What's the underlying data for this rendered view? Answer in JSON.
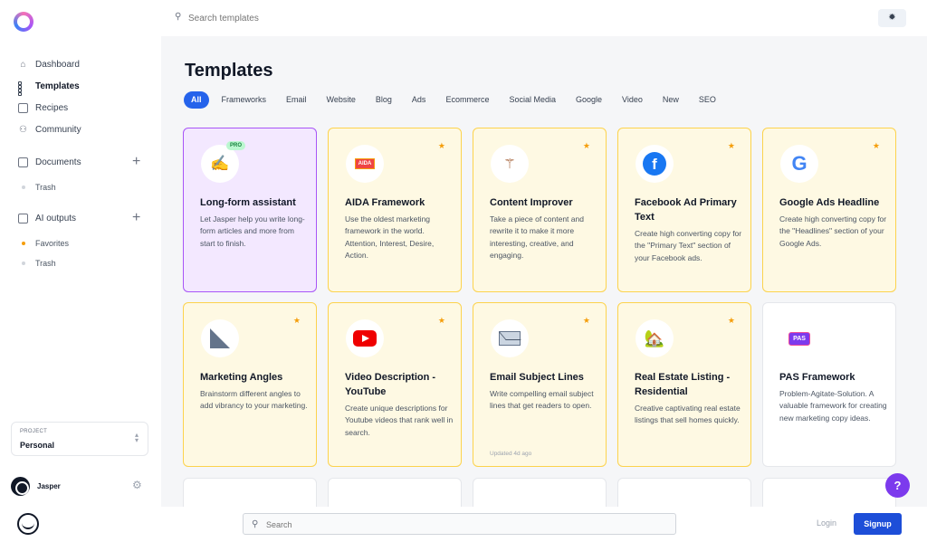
{
  "search": {
    "placeholder": "Search templates"
  },
  "sidebar": {
    "nav": [
      {
        "label": "Dashboard",
        "icon": "home-icon"
      },
      {
        "label": "Templates",
        "icon": "grid-icon",
        "active": true
      },
      {
        "label": "Recipes",
        "icon": "recipe-icon"
      },
      {
        "label": "Community",
        "icon": "community-icon"
      }
    ],
    "documents": {
      "label": "Documents",
      "items": [
        {
          "label": "Trash"
        }
      ]
    },
    "ai_outputs": {
      "label": "AI outputs",
      "items": [
        {
          "label": "Favorites"
        },
        {
          "label": "Trash"
        }
      ]
    },
    "project": {
      "label": "PROJECT",
      "value": "Personal"
    },
    "user": {
      "name": "Jasper"
    }
  },
  "main": {
    "title": "Templates",
    "tabs": [
      "All",
      "Frameworks",
      "Email",
      "Website",
      "Blog",
      "Ads",
      "Ecommerce",
      "Social Media",
      "Google",
      "Video",
      "New",
      "SEO"
    ],
    "cards": [
      {
        "title": "Long-form assistant",
        "desc": "Let Jasper help you write long-form articles and more from start to finish.",
        "badge": "PRO",
        "icon": "pen-icon"
      },
      {
        "title": "AIDA Framework",
        "desc": "Use the oldest marketing framework in the world. Attention, Interest, Desire, Action.",
        "icon": "aida-icon"
      },
      {
        "title": "Content Improver",
        "desc": "Take a piece of content and rewrite it to make it more interesting, creative, and engaging.",
        "icon": "magic-wand-icon"
      },
      {
        "title": "Facebook Ad Primary Text",
        "desc": "Create high converting copy for the \"Primary Text\" section of your Facebook ads.",
        "icon": "facebook-icon"
      },
      {
        "title": "Google Ads Headline",
        "desc": "Create high converting copy for the \"Headlines\" section of your Google Ads.",
        "icon": "google-icon"
      },
      {
        "title": "Marketing Angles",
        "desc": "Brainstorm different angles to add vibrancy to your marketing.",
        "icon": "triangle-ruler-icon"
      },
      {
        "title": "Video Description - YouTube",
        "desc": "Create unique descriptions for Youtube videos that rank well in search.",
        "icon": "youtube-icon"
      },
      {
        "title": "Email Subject Lines",
        "desc": "Write compelling email subject lines that get readers to open.",
        "updated": "Updated 4d ago",
        "icon": "mail-icon"
      },
      {
        "title": "Real Estate Listing - Residential",
        "desc": "Creative captivating real estate listings that sell homes quickly.",
        "icon": "house-icon"
      },
      {
        "title": "PAS Framework",
        "desc": "Problem-Agitate-Solution. A valuable framework for creating new marketing copy ideas.",
        "icon": "pas-icon"
      }
    ]
  },
  "bottom": {
    "search_placeholder": "Search",
    "login": "Login",
    "signup": "Signup"
  },
  "help": "?",
  "colors": {
    "accent": "#2563eb",
    "card_border": "#fcd34d",
    "card_bg": "#fef9e3",
    "pro_card_border": "#a855f7",
    "help_button": "#7c3aed"
  }
}
